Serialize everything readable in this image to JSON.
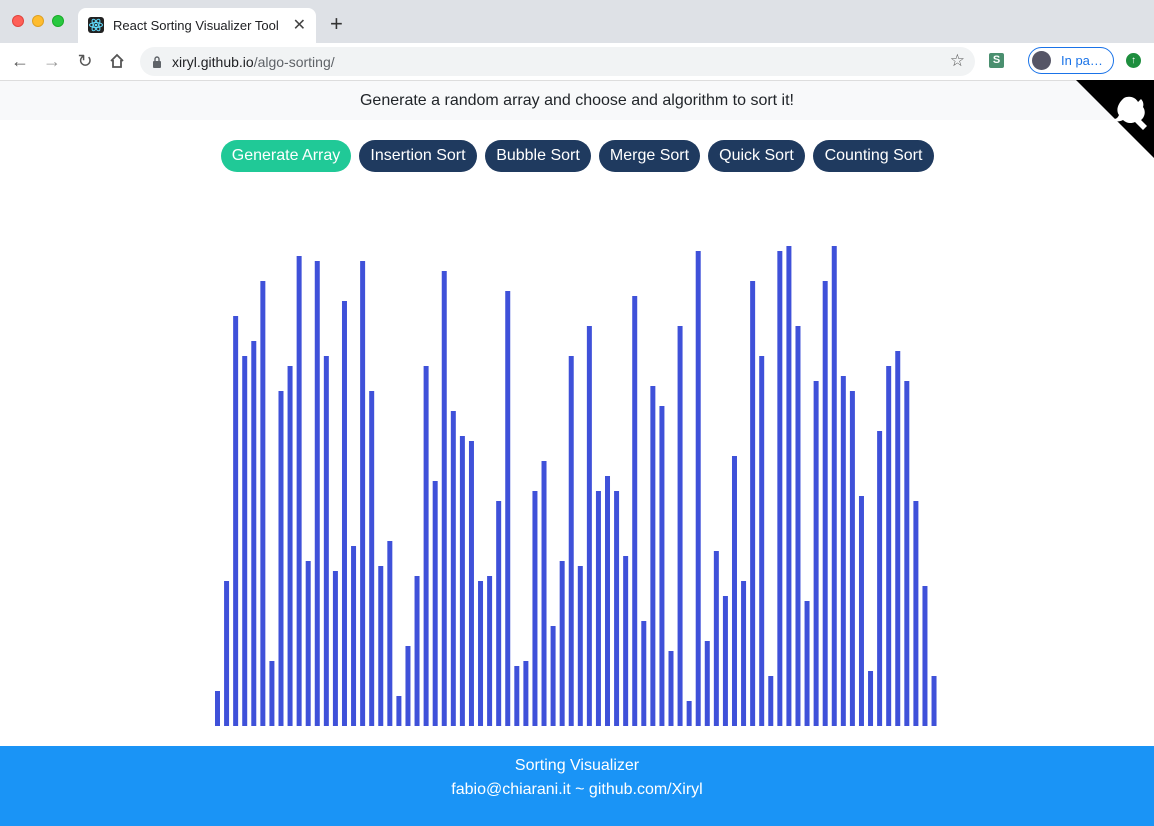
{
  "browser": {
    "tab_title": "React Sorting Visualizer Tool",
    "tab_close": "✕",
    "new_tab": "+",
    "url_host": "xiryl.github.io",
    "url_path": "/algo-sorting/",
    "profile_label": "In pa…",
    "extension_label": "S"
  },
  "page": {
    "banner_text": "Generate a random array and choose and algorithm to sort it!",
    "buttons": {
      "generate": "Generate Array",
      "insertion": "Insertion Sort",
      "bubble": "Bubble Sort",
      "merge": "Merge Sort",
      "quick": "Quick Sort",
      "counting": "Counting Sort"
    },
    "bar_color": "#3f51d9",
    "primary_color": "#20c997",
    "dark_button_color": "#1f3a5f",
    "footer_color": "#1a94f6",
    "footer": {
      "title": "Sorting Visualizer",
      "links": "fabio@chiarani.it ~ github.com/Xiryl"
    }
  },
  "chart_data": {
    "type": "bar",
    "values": [
      35,
      145,
      410,
      370,
      385,
      445,
      65,
      335,
      360,
      470,
      165,
      465,
      370,
      155,
      425,
      180,
      465,
      335,
      160,
      185,
      30,
      80,
      150,
      360,
      245,
      455,
      315,
      290,
      285,
      145,
      150,
      225,
      435,
      60,
      65,
      235,
      265,
      100,
      165,
      370,
      160,
      400,
      235,
      250,
      235,
      170,
      430,
      105,
      340,
      320,
      75,
      400,
      25,
      475,
      85,
      175,
      130,
      270,
      145,
      445,
      370,
      50,
      475,
      480,
      400,
      125,
      345,
      445,
      480,
      350,
      335,
      230,
      55,
      295,
      360,
      375,
      345,
      225,
      140,
      50
    ],
    "ylim": [
      0,
      480
    ]
  }
}
